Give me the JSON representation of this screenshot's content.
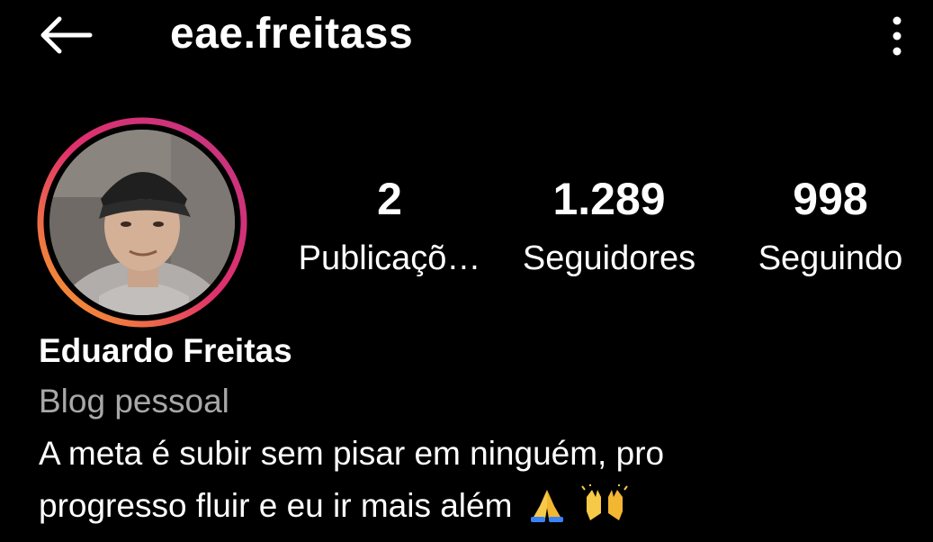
{
  "header": {
    "username": "eae.freitass",
    "back_icon": "arrow-left-icon",
    "more_icon": "more-vertical-icon"
  },
  "profile": {
    "avatar_alt": "avatar",
    "stats": [
      {
        "value": "2",
        "label": "Publicaçõ…"
      },
      {
        "value": "1.289",
        "label": "Seguidores"
      },
      {
        "value": "998",
        "label": "Seguindo"
      }
    ],
    "full_name": "Eduardo Freitas",
    "category": "Blog pessoal",
    "bio_lines": [
      "A meta é subir sem pisar em ninguém, pro",
      "progresso fluir e eu ir mais além"
    ],
    "bio_emojis": [
      "folded-hands-icon",
      "raised-hands-icon"
    ]
  },
  "colors": {
    "background": "#000000",
    "text": "#ffffff",
    "secondary_text": "#a8a8a8",
    "story_ring_start": "#f9a825",
    "story_ring_mid": "#e1306c",
    "story_ring_end": "#c13584"
  }
}
